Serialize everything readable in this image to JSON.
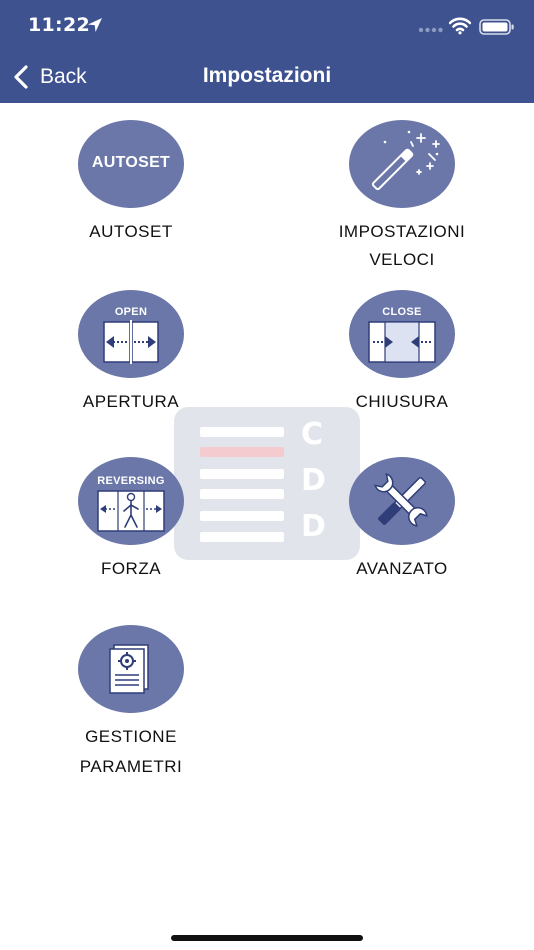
{
  "status_bar": {
    "time": "11:22"
  },
  "nav": {
    "back_label": "Back",
    "title": "Impostazioni"
  },
  "tiles": [
    {
      "id": "autoset",
      "label": "AUTOSET",
      "badge": "AUTOSET",
      "icon": "autoset-icon"
    },
    {
      "id": "impostazioni-veloci",
      "label_line1": "IMPOSTAZIONI",
      "label_line2": "VELOCI",
      "icon": "magic-wand-icon"
    },
    {
      "id": "apertura",
      "label": "APERTURA",
      "badge": "OPEN",
      "icon": "door-open-icon"
    },
    {
      "id": "chiusura",
      "label": "CHIUSURA",
      "badge": "CLOSE",
      "icon": "door-close-icon"
    },
    {
      "id": "forza",
      "label": "FORZA",
      "badge": "REVERSING",
      "icon": "reversing-icon"
    },
    {
      "id": "avanzato",
      "label": "AVANZATO",
      "icon": "tools-icon"
    },
    {
      "id": "gestione-parametri",
      "label_line1": "GESTIONE",
      "label_line2": "PARAMETRI",
      "icon": "document-gear-icon"
    }
  ],
  "watermark": {
    "letters": [
      "C",
      "D",
      "D"
    ]
  },
  "colors": {
    "nav_bg": "#3f5290",
    "icon_circle": "#6a77a8",
    "icon_dark": "#2f3d78",
    "watermark_bg": "#dfe3ea",
    "watermark_accent": "#f4c8cc"
  }
}
